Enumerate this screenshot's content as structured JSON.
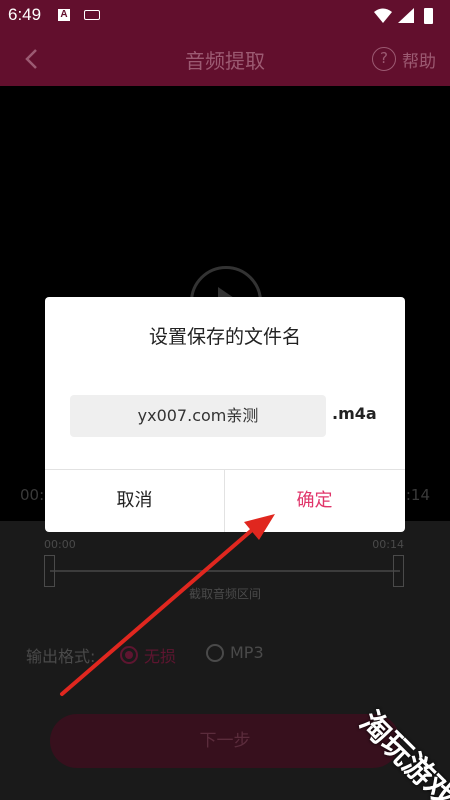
{
  "status_bar": {
    "time": "6:49",
    "notification_letter": "A"
  },
  "app_bar": {
    "title": "音频提取",
    "help_icon_glyph": "?",
    "help_label": "帮助"
  },
  "video": {
    "time_start": "00:",
    "time_end": ":14"
  },
  "range": {
    "start": "00:00",
    "end": "00:14",
    "caption": "截取音频区间"
  },
  "format": {
    "label": "输出格式:",
    "options": [
      {
        "label": "无损",
        "selected": true
      },
      {
        "label": "MP3",
        "selected": false
      }
    ]
  },
  "next_button": "下一步",
  "dialog": {
    "title": "设置保存的文件名",
    "filename_value": "yx007.com亲测",
    "extension": ".m4a",
    "cancel_label": "取消",
    "confirm_label": "确定"
  },
  "watermark": "淘玩游戏",
  "colors": {
    "brand": "#620f2d",
    "accent": "#e0356a",
    "arrow": "#e0271f"
  }
}
